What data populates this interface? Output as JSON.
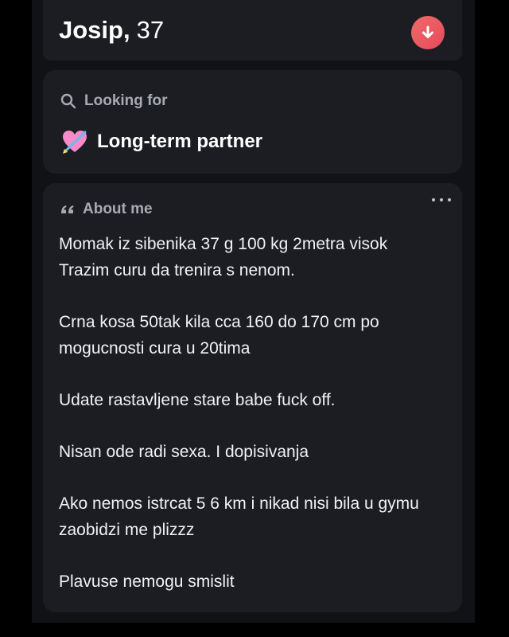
{
  "profile": {
    "name": "Josip,",
    "age": "37",
    "down_button_icon": "arrow-down-icon",
    "accent": "#e95360"
  },
  "looking_for": {
    "label": "Looking for",
    "value": "Long-term partner",
    "label_icon": "search-icon",
    "value_icon": "heart-with-arrow-icon"
  },
  "about": {
    "label": "About me",
    "label_icon": "quote-icon",
    "more_icon": "more-dots-icon",
    "paragraphs": [
      "Momak iz sibenika 37 g 100 kg 2metra visok\nTrazim curu da trenira s nenom.",
      "Crna kosa 50tak kila cca 160 do 170 cm po mogucnosti cura u 20tima",
      "Udate rastavljene stare babe fuck off.",
      "Nisan ode radi sexa. I dopisivanja",
      "Ako nemos istrcat 5 6 km i nikad nisi bila u gymu zaobidzi me plizzz",
      "Plavuse nemogu smislit"
    ]
  }
}
